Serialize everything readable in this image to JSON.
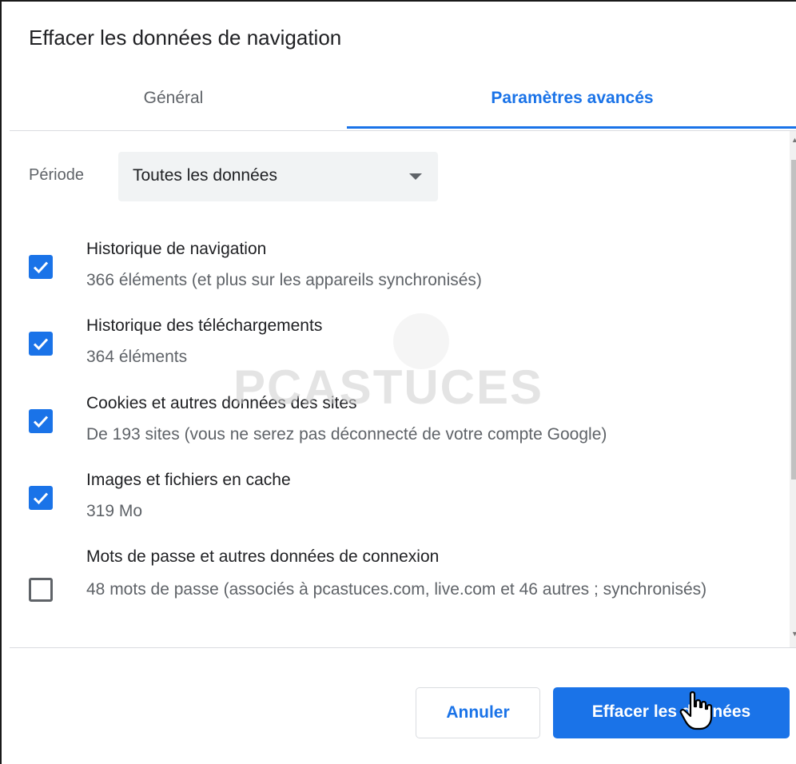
{
  "dialog": {
    "title": "Effacer les données de navigation"
  },
  "tabs": [
    {
      "label": "Général",
      "active": false
    },
    {
      "label": "Paramètres avancés",
      "active": true
    }
  ],
  "period": {
    "label": "Période",
    "selected": "Toutes les données"
  },
  "items": [
    {
      "title": "Historique de navigation",
      "description": "366 éléments (et plus sur les appareils synchronisés)",
      "checked": true
    },
    {
      "title": "Historique des téléchargements",
      "description": "364 éléments",
      "checked": true
    },
    {
      "title": "Cookies et autres données des sites",
      "description": "De 193 sites (vous ne serez pas déconnecté de votre compte Google)",
      "checked": true
    },
    {
      "title": "Images et fichiers en cache",
      "description": "319 Mo",
      "checked": true
    },
    {
      "title": "Mots de passe et autres données de connexion",
      "description": "48 mots de passe (associés à pcastuces.com, live.com et 46 autres ; synchronisés)",
      "checked": false
    }
  ],
  "buttons": {
    "cancel": "Annuler",
    "clear": "Effacer les données"
  },
  "watermark": {
    "text": "PCASTUCES"
  },
  "colors": {
    "accent": "#1a73e8",
    "text_primary": "#202124",
    "text_secondary": "#5f6368"
  },
  "icons": {
    "checkbox": "check-icon",
    "dropdown": "caret-down-icon",
    "cursor": "hand-pointer-icon"
  }
}
